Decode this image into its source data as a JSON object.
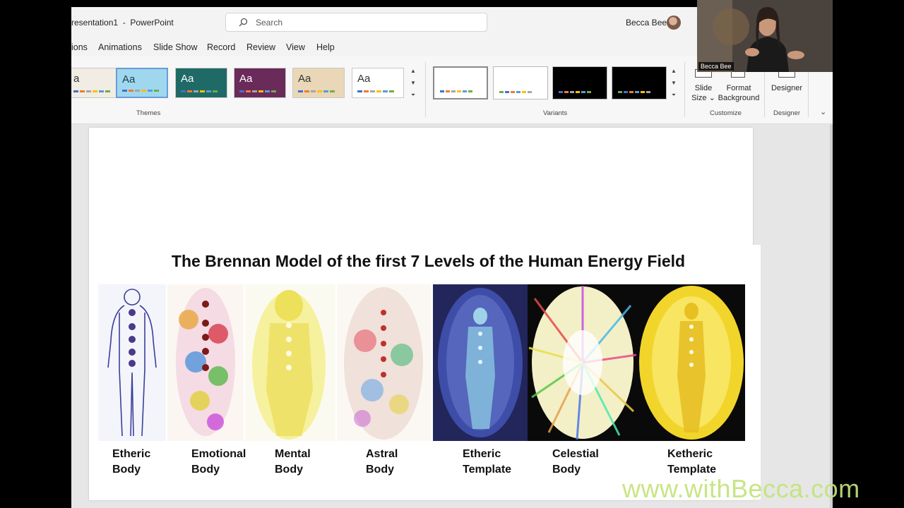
{
  "window": {
    "doc_title": "resentation1  -  PowerPoint",
    "user_name": "Becca Bee"
  },
  "search": {
    "placeholder": "Search"
  },
  "tabs": [
    "ions",
    "Animations",
    "Slide Show",
    "Record",
    "Review",
    "View",
    "Help"
  ],
  "ribbon": {
    "themes": [
      {
        "label": "a",
        "bg": "#f1ece4",
        "fg": "#333333"
      },
      {
        "label": "Aa",
        "bg": "#9fd7ee",
        "fg": "#1f3c4a"
      },
      {
        "label": "Aa",
        "bg": "#1f6a66",
        "fg": "#ffffff"
      },
      {
        "label": "Aa",
        "bg": "#6a2a5a",
        "fg": "#ffffff"
      },
      {
        "label": "Aa",
        "bg": "#e9d7b8",
        "fg": "#333333"
      },
      {
        "label": "Aa",
        "bg": "#ffffff",
        "fg": "#333333"
      }
    ],
    "themes_group_label": "Themes",
    "variants_group_label": "Variants",
    "customize_group_label": "Customize",
    "designer_group_label": "Designer",
    "slide_size_label": [
      "Slide",
      "Size"
    ],
    "format_background_label": [
      "Format",
      "Background"
    ],
    "designer_button_label": "Designer"
  },
  "slide": {
    "heading": "The Brennan Model of the first 7 Levels of the Human Energy Field",
    "figures": [
      {
        "label": [
          "Etheric",
          "Body"
        ],
        "icon": "etheric-body-figure"
      },
      {
        "label": [
          "Emotional",
          "Body"
        ],
        "icon": "emotional-body-figure"
      },
      {
        "label": [
          "Mental",
          "Body"
        ],
        "icon": "mental-body-figure"
      },
      {
        "label": [
          "Astral",
          "Body"
        ],
        "icon": "astral-body-figure"
      },
      {
        "label": [
          "Etheric",
          "Template"
        ],
        "icon": "etheric-template-figure"
      },
      {
        "label": [
          "Celestial",
          "Body"
        ],
        "icon": "celestial-body-figure"
      },
      {
        "label": [
          "Ketheric",
          "Template"
        ],
        "icon": "ketheric-template-figure"
      }
    ]
  },
  "webcam": {
    "name": "Becca Bee"
  },
  "watermark": "www.withBecca.com"
}
